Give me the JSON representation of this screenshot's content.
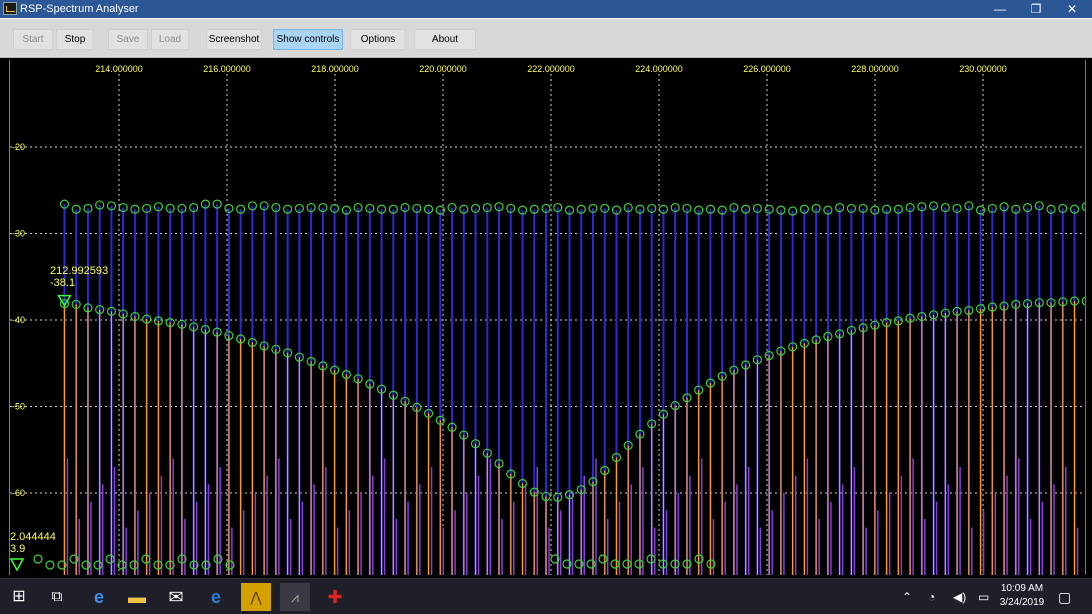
{
  "window": {
    "title": "RSP-Spectrum Analyser",
    "controls": {
      "minimize": "—",
      "restore": "❐",
      "close": "✕"
    }
  },
  "toolbar": {
    "buttons": [
      {
        "label": "Start",
        "enabled": false
      },
      {
        "label": "Stop",
        "enabled": true
      },
      {
        "label": "Save",
        "enabled": false
      },
      {
        "label": "Load",
        "enabled": false
      },
      {
        "label": "Screenshot",
        "enabled": true
      },
      {
        "label": "Show controls",
        "enabled": true,
        "active": true
      },
      {
        "label": "Options",
        "enabled": true
      },
      {
        "label": "About",
        "enabled": true
      }
    ]
  },
  "chart_data": {
    "type": "line",
    "x_ticks": [
      "214.000000",
      "216.000000",
      "218.000000",
      "220.000000",
      "222.000000",
      "224.000000",
      "226.000000",
      "228.000000",
      "230.000000"
    ],
    "x_tick_values": [
      214,
      216,
      218,
      220,
      222,
      224,
      226,
      228,
      230
    ],
    "y_ticks": [
      "-20",
      "-30",
      "-40",
      "-50",
      "-60"
    ],
    "y_tick_values": [
      -20,
      -30,
      -40,
      -50,
      -60
    ],
    "xlim": [
      212.0,
      231.5
    ],
    "ylim": [
      -70,
      -10
    ],
    "grid": true,
    "series": [
      {
        "style": "peak-hold",
        "x_start": 212.99,
        "x_step": 0.2175,
        "values": [
          -26.6,
          -27.2,
          -27.1,
          -26.7,
          -26.8,
          -27.0,
          -27.2,
          -27.1,
          -26.9,
          -27.1,
          -27.1,
          -27.0,
          -26.6,
          -26.6,
          -27.1,
          -27.2,
          -26.8,
          -26.8,
          -27.0,
          -27.2,
          -27.1,
          -27.0,
          -27.0,
          -27.1,
          -27.3,
          -27.0,
          -27.1,
          -27.2,
          -27.2,
          -27.0,
          -27.1,
          -27.2,
          -27.3,
          -27.0,
          -27.2,
          -27.1,
          -27.0,
          -26.9,
          -27.1,
          -27.3,
          -27.2,
          -27.1,
          -27.0,
          -27.3,
          -27.2,
          -27.1,
          -27.1,
          -27.3,
          -27.0,
          -27.2,
          -27.1,
          -27.2,
          -27.0,
          -27.1,
          -27.3,
          -27.2,
          -27.3,
          -27.0,
          -27.2,
          -27.1,
          -27.2,
          -27.3,
          -27.4,
          -27.2,
          -27.1,
          -27.3,
          -27.0,
          -27.1,
          -27.1,
          -27.3,
          -27.2,
          -27.2,
          -27.0,
          -26.9,
          -26.8,
          -27.0,
          -27.1,
          -26.8,
          -27.3,
          -27.1,
          -26.9,
          -27.2,
          -27.0,
          -26.8,
          -27.2,
          -27.1,
          -27.2,
          -26.9,
          -27.2,
          -27.2,
          -27.0,
          -26.8,
          -26.8
        ]
      },
      {
        "style": "trace",
        "x_start": 212.99,
        "x_step": 0.2175,
        "values": [
          -38.1,
          -38.2,
          -38.6,
          -38.8,
          -39.0,
          -39.3,
          -39.6,
          -39.9,
          -40.1,
          -40.3,
          -40.5,
          -40.8,
          -41.1,
          -41.4,
          -41.8,
          -42.2,
          -42.6,
          -43.0,
          -43.4,
          -43.8,
          -44.3,
          -44.8,
          -45.3,
          -45.8,
          -46.3,
          -46.8,
          -47.4,
          -48.0,
          -48.7,
          -49.4,
          -50.1,
          -50.8,
          -51.6,
          -52.4,
          -53.3,
          -54.3,
          -55.4,
          -56.6,
          -57.8,
          -58.9,
          -59.9,
          -60.4,
          -60.5,
          -60.2,
          -59.6,
          -58.7,
          -57.4,
          -55.9,
          -54.5,
          -53.2,
          -52.0,
          -50.9,
          -49.9,
          -49.0,
          -48.1,
          -47.3,
          -46.5,
          -45.8,
          -45.2,
          -44.6,
          -44.1,
          -43.6,
          -43.1,
          -42.7,
          -42.3,
          -41.9,
          -41.6,
          -41.2,
          -40.9,
          -40.6,
          -40.3,
          -40.1,
          -39.8,
          -39.6,
          -39.4,
          -39.2,
          -39.0,
          -38.9,
          -38.7,
          -38.5,
          -38.4,
          -38.2,
          -38.1,
          -38.0,
          -38.0,
          -37.9,
          -37.8,
          -37.8,
          -37.9,
          -38.0,
          -38.1,
          -38.2,
          -38.1
        ]
      }
    ]
  },
  "markers": [
    {
      "freq": "212.992593",
      "level": "-38.1"
    },
    {
      "freq": "2.044444",
      "level": "3.9"
    }
  ],
  "taskbar": {
    "icons": [
      "windows-start-icon",
      "task-view-icon",
      "edge-icon",
      "file-explorer-icon",
      "mail-icon",
      "ie-icon",
      "sdrplay-icon",
      "spectrum-analyser-icon",
      "tool-icon"
    ],
    "time": "10:09 AM",
    "date": "3/24/2019"
  }
}
